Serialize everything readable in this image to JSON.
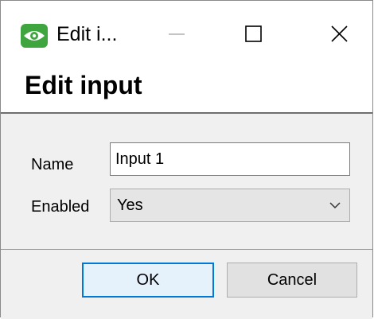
{
  "window": {
    "title": "Edit i...",
    "app_icon": "eye-icon",
    "controls": [
      "minimize-icon",
      "maximize-icon",
      "close-icon"
    ]
  },
  "header": {
    "title": "Edit input"
  },
  "form": {
    "name_label": "Name",
    "name_value": "Input 1",
    "enabled_label": "Enabled",
    "enabled_value": "Yes"
  },
  "buttons": {
    "ok_label": "OK",
    "cancel_label": "Cancel"
  },
  "colors": {
    "app_icon_bg": "#3fa53f",
    "default_button_border": "#0078d7",
    "dialog_bg": "#f0f0f0"
  }
}
